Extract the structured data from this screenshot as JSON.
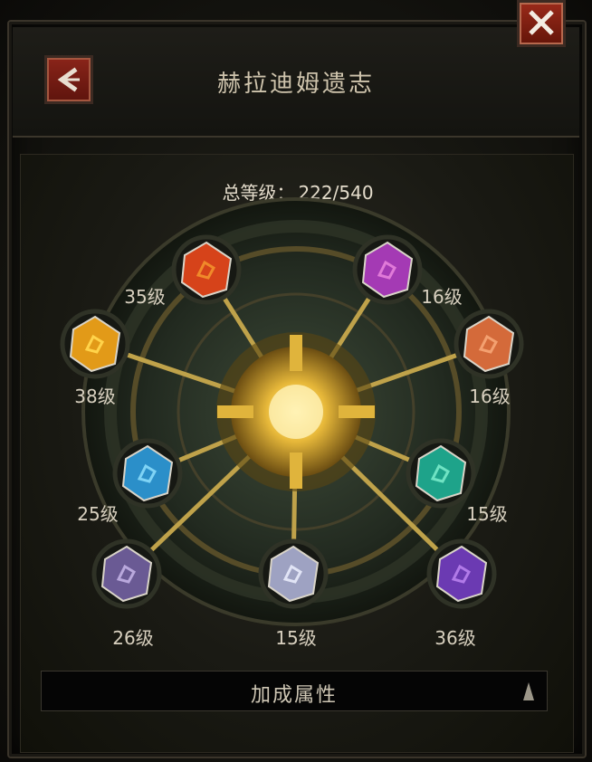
{
  "header": {
    "title": "赫拉迪姆遗志"
  },
  "summary": {
    "total_label": "总等级：",
    "total_value": "222/540"
  },
  "gems": [
    {
      "level": "35级",
      "color": "#d6431a",
      "accent": "#f08a2a"
    },
    {
      "level": "16级",
      "color": "#a43ab4",
      "accent": "#e07ad8"
    },
    {
      "level": "38级",
      "color": "#e29a18",
      "accent": "#ffd34a"
    },
    {
      "level": "16级",
      "color": "#d46a3a",
      "accent": "#f3a070"
    },
    {
      "level": "25级",
      "color": "#2b8fc9",
      "accent": "#7fd3f5"
    },
    {
      "level": "15级",
      "color": "#1ea38a",
      "accent": "#6fe3c3"
    },
    {
      "level": "26级",
      "color": "#6a5a94",
      "accent": "#b9a8dc"
    },
    {
      "level": "15级",
      "color": "#9ea2c2",
      "accent": "#e1e4f5"
    },
    {
      "level": "36级",
      "color": "#6b3ab2",
      "accent": "#b17ae8"
    }
  ],
  "bonus": {
    "label": "加成属性"
  },
  "icons": {
    "back": "back-arrow-icon",
    "close": "close-icon",
    "expand": "chevron-up-icon"
  }
}
